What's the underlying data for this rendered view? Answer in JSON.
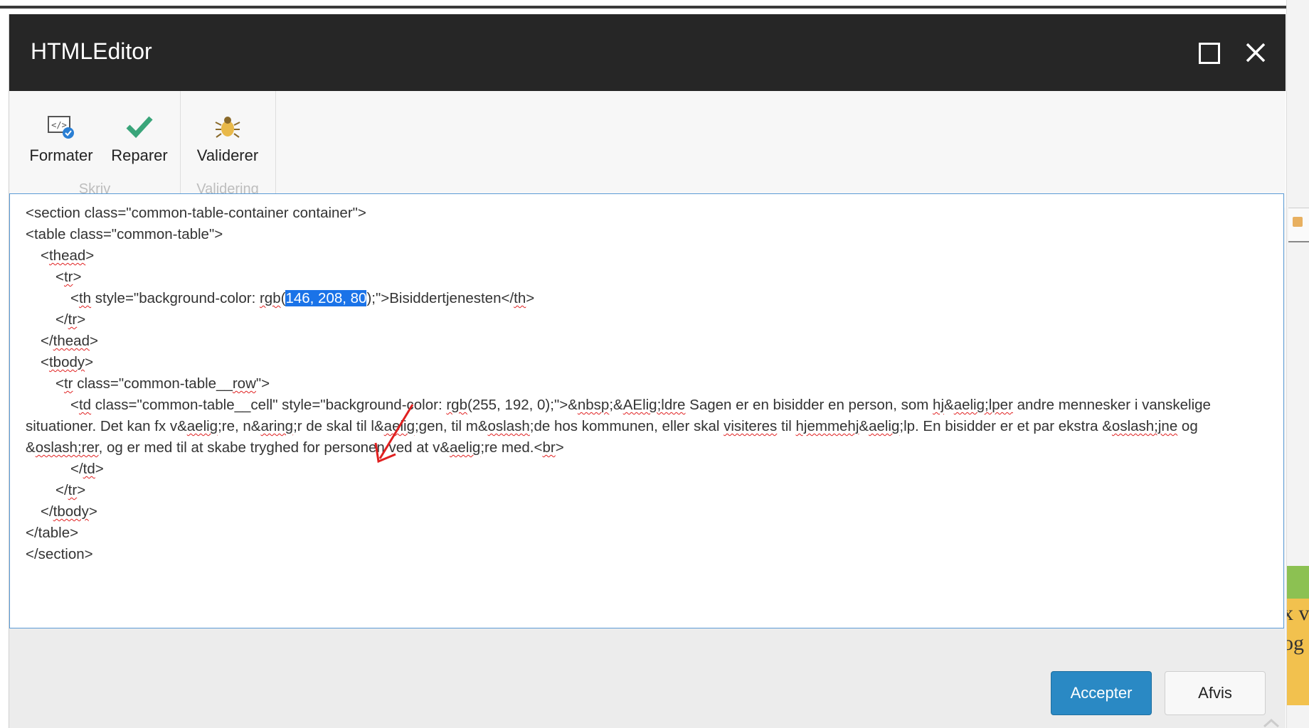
{
  "window": {
    "title": "HTMLEditor",
    "maximize_icon": "maximize-icon",
    "close_icon": "close-icon"
  },
  "ribbon": {
    "groups": [
      {
        "name": "Skriv",
        "buttons": [
          {
            "label": "Formater",
            "icon": "format-code-icon"
          },
          {
            "label": "Reparer",
            "icon": "checkmark-icon"
          }
        ]
      },
      {
        "name": "Validering",
        "buttons": [
          {
            "label": "Validerer",
            "icon": "bug-icon"
          }
        ]
      }
    ]
  },
  "editor": {
    "selected_text": "146, 208, 80",
    "lines": [
      "<section class=\"common-table-container container\">",
      "<table class=\"common-table\">",
      "<thead>",
      "<tr>",
      "<th style=\"background-color: rgb(146, 208, 80);\">Bisiddertjenesten</th>",
      "</tr>",
      "</thead>",
      "<tbody>",
      "<tr class=\"common-table__row\">",
      "<td class=\"common-table__cell\" style=\"background-color: rgb(255, 192, 0);\">&nbsp;&AElig;ldre Sagen er en bisidder en person, som hj&aelig;lper andre mennesker i vanskelige situationer. Det kan fx v&aelig;re, n&aring;r de skal til l&aelig;gen, til m&oslash;de hos kommunen, eller skal visiteres til hjemmehj&aelig;lp. En bisidder er et par ekstra &oslash;jne og &oslash;rer, og er med til at skabe tryghed for personen ved at v&aelig;re med.<br>",
      "</td>",
      "</tr>",
      "</tbody>",
      "</table>",
      "</section>"
    ]
  },
  "footer": {
    "accept_label": "Accepter",
    "reject_label": "Afvis"
  },
  "background": {
    "partial_text_1": "x v",
    "partial_text_2": "og"
  },
  "colors": {
    "titlebar": "#262626",
    "accept": "#2a89c4",
    "selection": "#1a73e8",
    "annotation_arrow": "#e02020",
    "spellcheck": "#e02020"
  }
}
